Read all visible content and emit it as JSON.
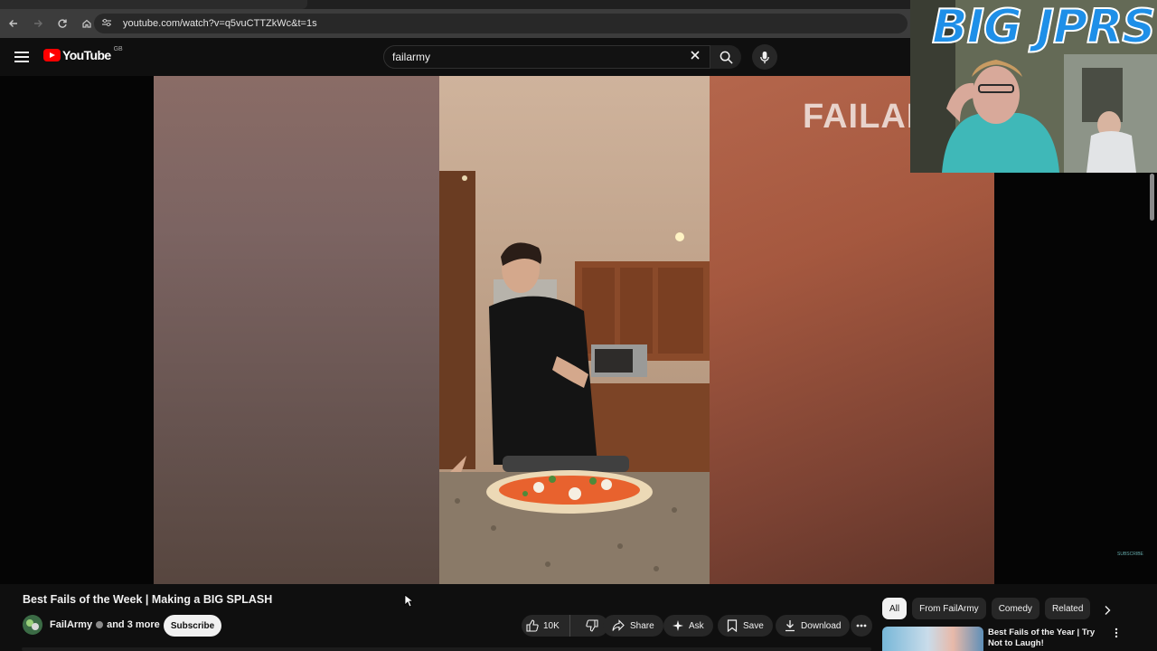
{
  "browser": {
    "url": "youtube.com/watch?v=q5vuCTTZkWc&t=1s"
  },
  "header": {
    "logo_text": "YouTube",
    "country_code": "GB",
    "search_value": "failarmy"
  },
  "player": {
    "watermark": "FAILARMY",
    "corner_text": "SUBSCRIBE"
  },
  "overlay": {
    "title": "BIG JPRS"
  },
  "video": {
    "title": "Best Fails of the Week | Making a BIG SPLASH",
    "channel": "FailArmy",
    "channel_more": "and 3 more",
    "subscribe_label": "Subscribe",
    "like_count": "10K",
    "share_label": "Share",
    "ask_label": "Ask",
    "save_label": "Save",
    "download_label": "Download"
  },
  "chips": [
    "All",
    "From FailArmy",
    "Comedy",
    "Related"
  ],
  "recommendation": {
    "title": "Best Fails of the Year | Try Not to Laugh!"
  },
  "colors": {
    "brand_red": "#ff0000",
    "background": "#0f0f0f",
    "pill": "#272727",
    "overlay_title": "#1e8fe8"
  },
  "icons": [
    "menu-icon",
    "back-icon",
    "forward-icon",
    "reload-icon",
    "home-icon",
    "site-settings-icon",
    "clear-icon",
    "search-icon",
    "mic-icon",
    "like-icon",
    "dislike-icon",
    "share-icon",
    "ask-sparkle-icon",
    "save-icon",
    "download-icon",
    "more-icon",
    "chevron-right-icon",
    "kebab-icon",
    "cursor-icon"
  ]
}
